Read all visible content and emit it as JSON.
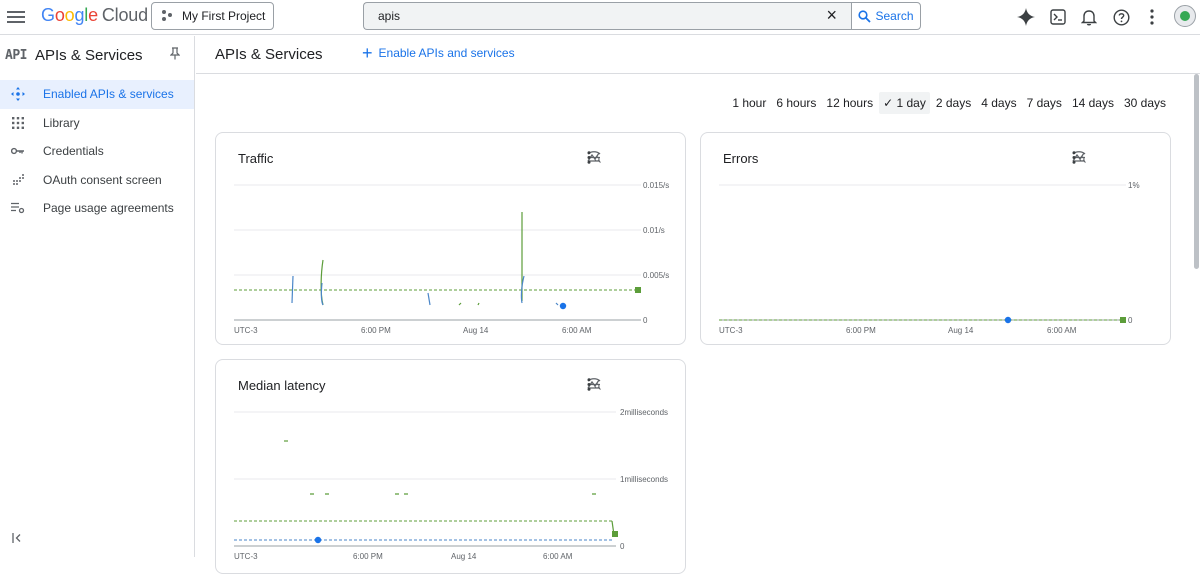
{
  "topbar": {
    "logo_letters": [
      "G",
      "o",
      "o",
      "g",
      "l",
      "e"
    ],
    "logo_suffix": "Cloud",
    "project": "My First Project",
    "search_value": "apis",
    "search_button": "Search"
  },
  "sidebar": {
    "title": "APIs & Services",
    "badge": "API",
    "items": [
      {
        "label": "Enabled APIs & services",
        "icon": "diamond-arrows-icon"
      },
      {
        "label": "Library",
        "icon": "library-grid-icon"
      },
      {
        "label": "Credentials",
        "icon": "key-icon"
      },
      {
        "label": "OAuth consent screen",
        "icon": "dotted-grid-icon"
      },
      {
        "label": "Page usage agreements",
        "icon": "list-settings-icon"
      }
    ]
  },
  "main": {
    "title": "APIs & Services",
    "enable_label": "Enable APIs and services",
    "time_options": [
      "1 hour",
      "6 hours",
      "12 hours",
      "1 day",
      "2 days",
      "4 days",
      "7 days",
      "14 days",
      "30 days"
    ],
    "selected_time": "1 day",
    "check_glyph": "✓"
  },
  "cards": {
    "traffic": {
      "title": "Traffic"
    },
    "errors": {
      "title": "Errors"
    },
    "latency": {
      "title": "Median latency"
    }
  },
  "chart_data": [
    {
      "type": "line",
      "title": "Traffic",
      "x_ticks": [
        "UTC-3",
        "6:00 PM",
        "Aug 14",
        "6:00 AM"
      ],
      "y_ticks": [
        "0",
        "0.005/s",
        "0.01/s",
        "0.015/s"
      ],
      "ylim": [
        0,
        0.015
      ]
    },
    {
      "type": "line",
      "title": "Errors",
      "x_ticks": [
        "UTC-3",
        "6:00 PM",
        "Aug 14",
        "6:00 AM"
      ],
      "y_ticks": [
        "0",
        "1%"
      ],
      "ylim": [
        0,
        1
      ]
    },
    {
      "type": "line",
      "title": "Median latency",
      "x_ticks": [
        "UTC-3",
        "6:00 PM",
        "Aug 14",
        "6:00 AM"
      ],
      "y_ticks": [
        "0",
        "1milliseconds",
        "2milliseconds"
      ],
      "ylim": [
        0,
        2
      ]
    }
  ],
  "colors": {
    "blue": "#1a73e8",
    "series_blue": "#4a86c8",
    "series_green": "#5c9d3a"
  }
}
